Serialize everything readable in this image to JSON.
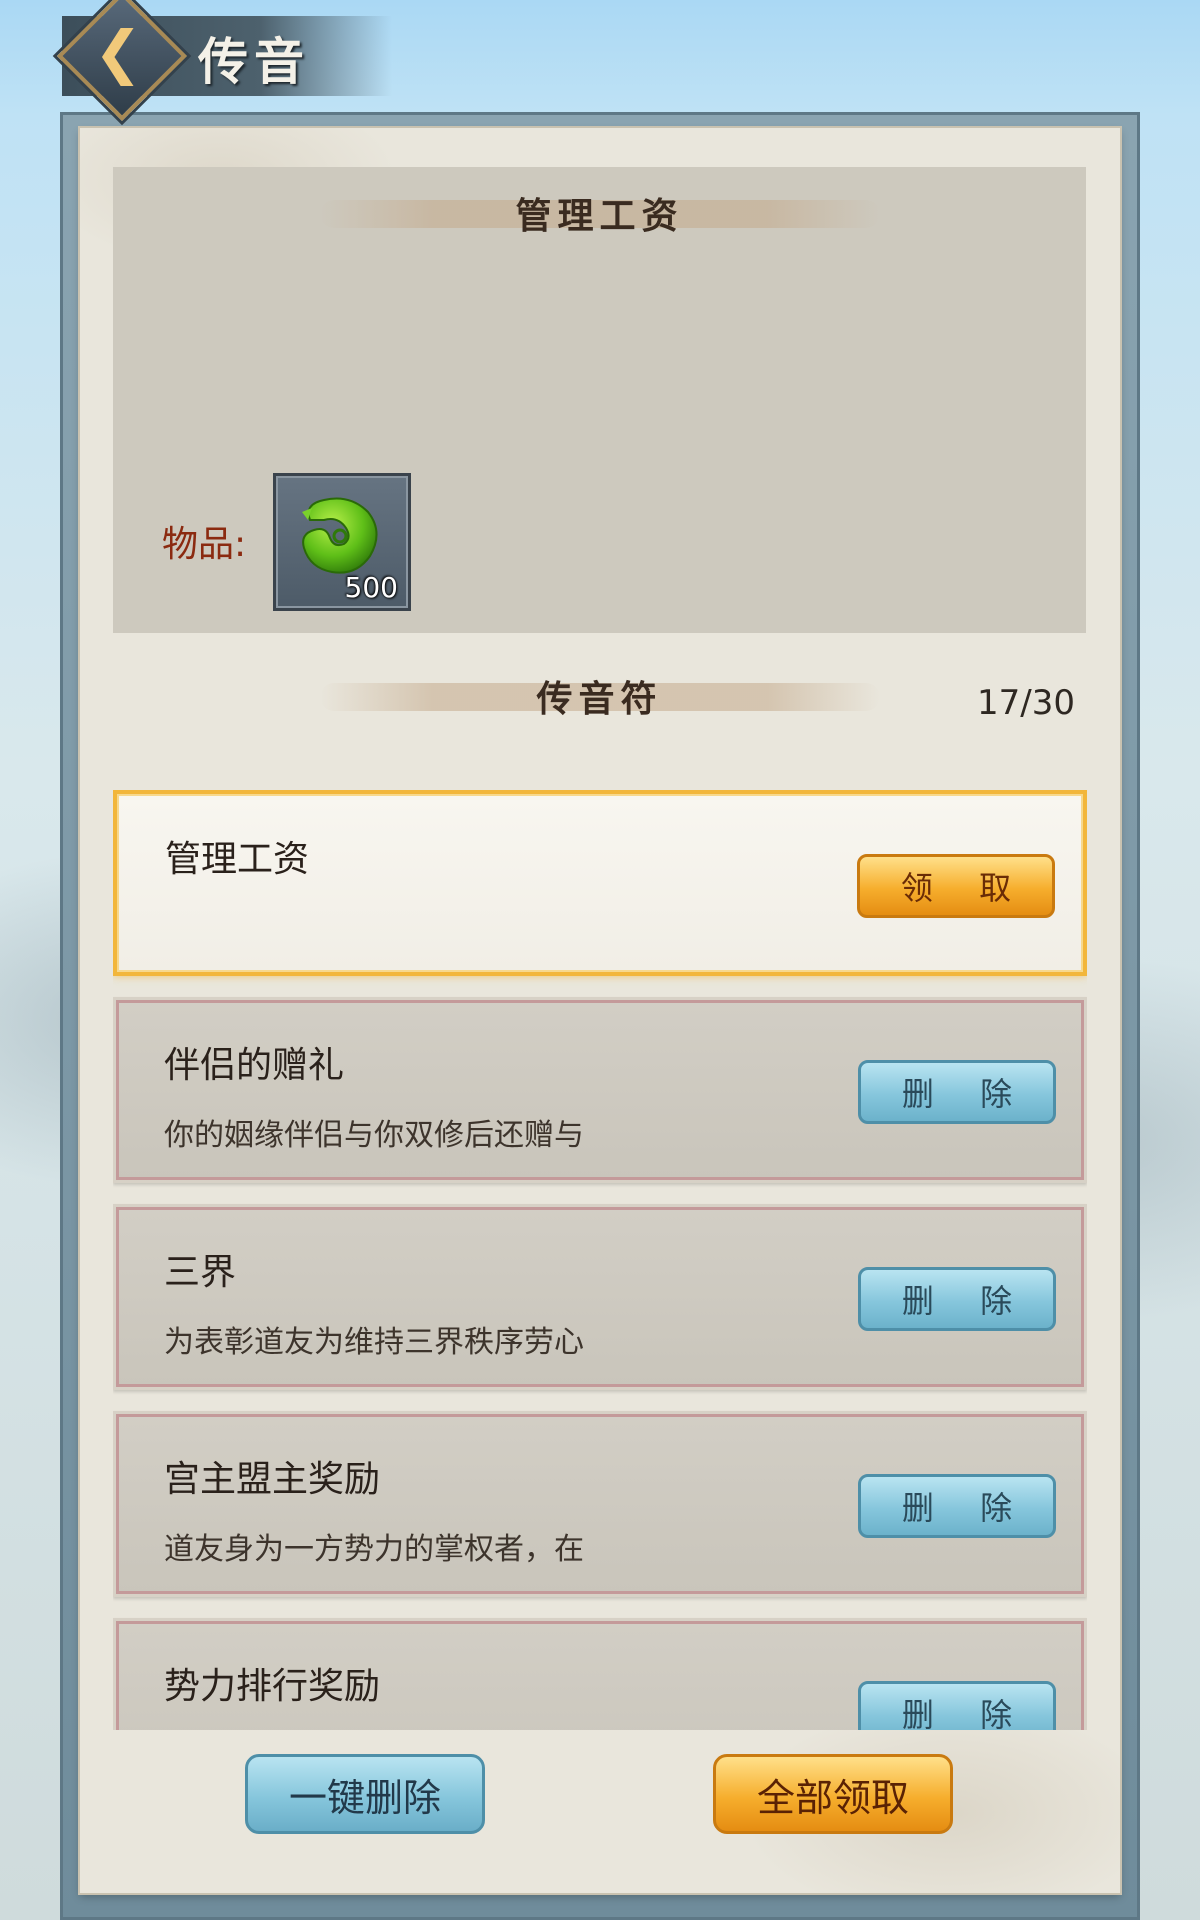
{
  "header": {
    "title": "传音",
    "back_icon": "back-chevron-icon"
  },
  "reward_panel": {
    "title": "管理工资",
    "items_label": "物品:",
    "item": {
      "icon": "jade-dragon-icon",
      "quantity": "500"
    }
  },
  "mail_section": {
    "title": "传音符",
    "count": "17/30"
  },
  "mails": [
    {
      "title": "管理工资",
      "desc": "",
      "action": "领 取",
      "selected": true
    },
    {
      "title": "伴侣的赠礼",
      "desc": "你的姻缘伴侣与你双修后还赠与",
      "action": "删 除",
      "selected": false
    },
    {
      "title": "三界",
      "desc": "为表彰道友为维持三界秩序劳心",
      "action": "删 除",
      "selected": false
    },
    {
      "title": "宫主盟主奖励",
      "desc": "道友身为一方势力的掌权者，在",
      "action": "删 除",
      "selected": false
    },
    {
      "title": "势力排行奖励",
      "desc": "",
      "action": "删 除",
      "selected": false
    }
  ],
  "footer": {
    "delete_all": "一键删除",
    "claim_all": "全部领取"
  },
  "colors": {
    "gold_button": "#f6ae2d",
    "blue_button": "#86c6dc",
    "label_red": "#8b2a10",
    "selected_border": "#f2b63b"
  }
}
